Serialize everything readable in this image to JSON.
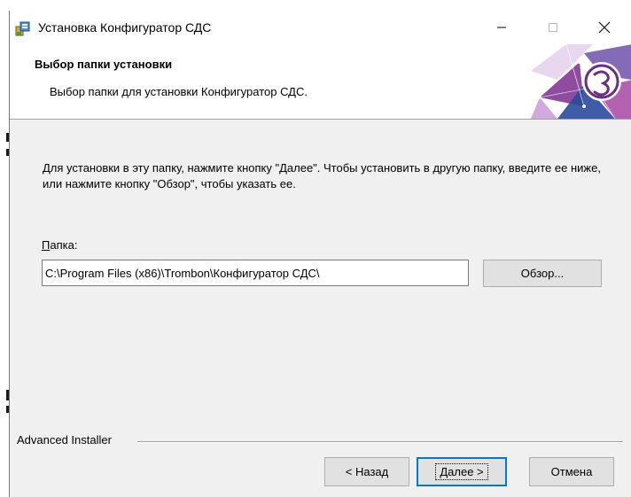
{
  "window": {
    "title": "Установка Конфигуратор СДС",
    "minimize_icon": "minimize-icon",
    "maximize_icon": "maximize-icon",
    "close_icon": "close-icon"
  },
  "header": {
    "title": "Выбор папки установки",
    "subtitle": "Выбор папки для установки Конфигуратор СДС."
  },
  "main": {
    "description": "Для установки в эту папку, нажмите кнопку \"Далее\". Чтобы установить в другую папку, введите ее ниже, или нажмите кнопку \"Обзор\", чтобы указать ее.",
    "folder_label_accel": "П",
    "folder_label_rest": "апка:",
    "folder_path": "C:\\Program Files (x86)\\Trombon\\Конфигуратор СДС\\",
    "browse_label": "Обзор..."
  },
  "footer": {
    "brand": "Advanced Installer",
    "back_label": "< Назад",
    "next_label": "Далее >",
    "cancel_label": "Отмена"
  },
  "colors": {
    "window_bg": "#f0f0f0",
    "focus_border": "#0078d7",
    "logo_purple": "#7b2b8f",
    "logo_blue": "#2a4a9c"
  }
}
